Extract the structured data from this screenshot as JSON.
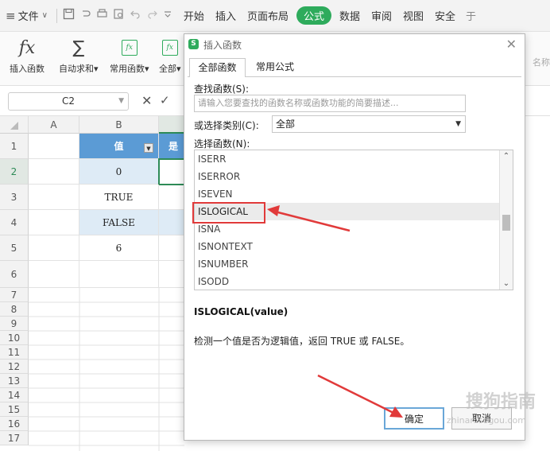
{
  "menubar": {
    "hamburger": "≡",
    "file": "文件",
    "file_caret": "∨",
    "tabs": [
      "开始",
      "插入",
      "页面布局",
      "公式",
      "数据",
      "审阅",
      "视图",
      "安全"
    ],
    "active_tab": "公式",
    "active_color": "#2eab5c",
    "cut_char": "于"
  },
  "ribbon": {
    "insert_func": "插入函数",
    "autosum": "自动求和",
    "common_func": "常用函数",
    "all_func": "全部",
    "caret": "▾",
    "right_cut": "名称"
  },
  "formulabar": {
    "cell_ref": "C2",
    "cancel": "✕",
    "confirm": "✓"
  },
  "grid": {
    "columns": [
      "A",
      "B"
    ],
    "rows": [
      "1",
      "2",
      "3",
      "4",
      "5",
      "6",
      "7",
      "8",
      "9",
      "10",
      "11",
      "12",
      "13",
      "14",
      "15",
      "16",
      "17"
    ],
    "header_value": "值",
    "b_values": [
      "0",
      "TRUE",
      "FALSE",
      "6"
    ],
    "selected_row": "2",
    "header_color": "#5b9bd5",
    "band_color": "#deebf6",
    "c1_partial": "是"
  },
  "dialog": {
    "title": "插入函数",
    "logo": "S",
    "close": "✕",
    "tabs": [
      "全部函数",
      "常用公式"
    ],
    "search_label": "查找函数(S):",
    "search_placeholder": "请输入您要查找的函数名称或函数功能的简要描述...",
    "category_label": "或选择类别(C):",
    "category_value": "全部",
    "select_label": "选择函数(N):",
    "functions": [
      "ISERR",
      "ISERROR",
      "ISEVEN",
      "ISLOGICAL",
      "ISNA",
      "ISNONTEXT",
      "ISNUMBER",
      "ISODD"
    ],
    "selected_function": "ISLOGICAL",
    "signature": "ISLOGICAL(value)",
    "description": "检测一个值是否为逻辑值，返回 TRUE 或 FALSE。",
    "ok_label": "确定",
    "cancel_label": "取消",
    "arrow_color": "#e13a3a"
  },
  "watermark": {
    "text": "搜狗指南",
    "url": "zhinan.sogou.com"
  }
}
